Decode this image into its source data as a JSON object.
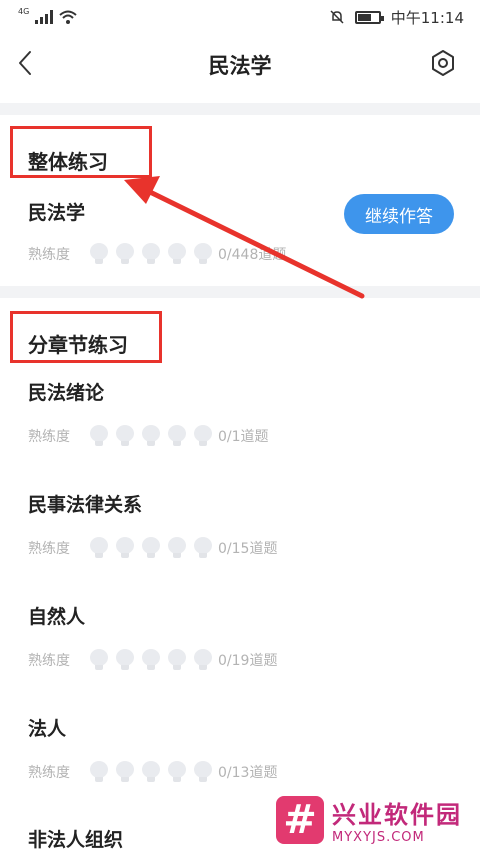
{
  "status": {
    "net": "4G",
    "time": "中午11:14"
  },
  "nav": {
    "title": "民法学"
  },
  "overall": {
    "section_title": "整体练习",
    "subject": "民法学",
    "continue_label": "继续作答",
    "prof_label": "熟练度",
    "count": "0/448道题"
  },
  "chapters": {
    "section_title": "分章节练习",
    "items": [
      {
        "title": "民法绪论",
        "prof_label": "熟练度",
        "count": "0/1道题"
      },
      {
        "title": "民事法律关系",
        "prof_label": "熟练度",
        "count": "0/15道题"
      },
      {
        "title": "自然人",
        "prof_label": "熟练度",
        "count": "0/19道题"
      },
      {
        "title": "法人",
        "prof_label": "熟练度",
        "count": "0/13道题"
      },
      {
        "title": "非法人组织"
      }
    ]
  },
  "watermark": {
    "logo": "#",
    "cn": "兴业软件园",
    "en": "MYXYJS.COM"
  },
  "colors": {
    "accent": "#3e95ec",
    "highlight": "#e8332c",
    "watermark": "#c2297a"
  }
}
